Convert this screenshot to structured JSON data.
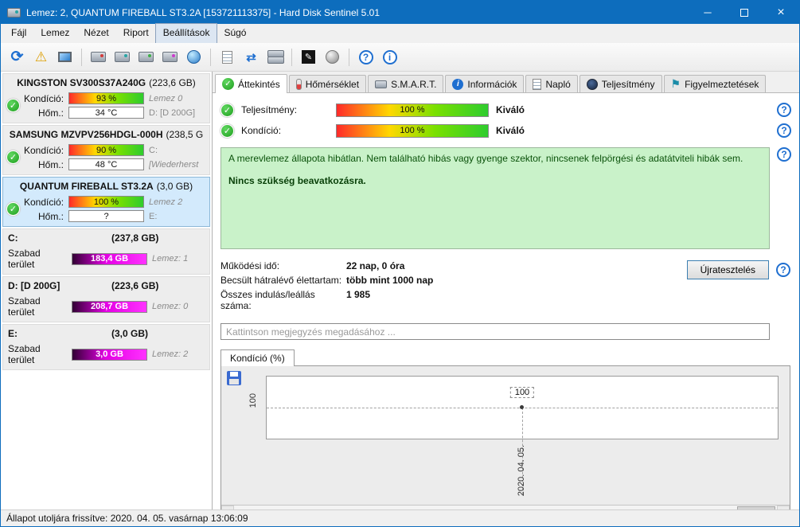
{
  "window": {
    "title": "Lemez: 2, QUANTUM FIREBALL ST3.2A [153721113375]  -  Hard Disk Sentinel 5.01"
  },
  "menu": {
    "items": [
      "Fájl",
      "Lemez",
      "Nézet",
      "Riport",
      "Beállítások",
      "Súgó"
    ]
  },
  "icons": {
    "check": "✓",
    "refresh": "⟳",
    "warning": "⚠",
    "sync": "⇄",
    "pencil": "✎",
    "flag": "⚑",
    "help": "?",
    "info": "i",
    "minimize": "─",
    "close": "×",
    "scroll_left": "◀",
    "scroll_right": "▶"
  },
  "colors": {
    "titlebar": "#0d6dbd",
    "accent_blue": "#1f6fd0",
    "selected_disk": "#d3eafc",
    "health_bg": "#c9f2c9",
    "health_text": "#0a520a",
    "status_green": "#1f9e1f",
    "condition_gradient_start": "#ff2a2a",
    "condition_gradient_mid": "#ffd800",
    "condition_gradient_end": "#2ecc2e",
    "free_space_magenta": "#e400e4"
  },
  "sidebar": {
    "disks": [
      {
        "name": "KINGSTON SV300S37A240G",
        "size": "(223,6 GB)",
        "condition_label": "Kondíció:",
        "condition_value": "93 %",
        "condition_note": "Lemez 0",
        "temp_label": "Hőm.:",
        "temp_value": "34 °C",
        "temp_note": "D: [D 200G]"
      },
      {
        "name": "SAMSUNG MZVPV256HDGL-000H",
        "size": "(238,5 G",
        "condition_label": "Kondíció:",
        "condition_value": "90 %",
        "condition_note": "C:",
        "temp_label": "Hőm.:",
        "temp_value": "48 °C",
        "temp_note": "[Wiederherst"
      },
      {
        "name": "QUANTUM FIREBALL ST3.2A",
        "size": "(3,0 GB)",
        "condition_label": "Kondíció:",
        "condition_value": "100 %",
        "condition_note": "Lemez 2",
        "temp_label": "Hőm.:",
        "temp_value": "?",
        "temp_note": "E:"
      }
    ],
    "partitions": [
      {
        "name": "C:",
        "size": "(237,8 GB)",
        "free_label": "Szabad terület",
        "free_value": "183,4 GB",
        "note": "Lemez: 1"
      },
      {
        "name": "D: [D 200G]",
        "size": "(223,6 GB)",
        "free_label": "Szabad terület",
        "free_value": "208,7 GB",
        "note": "Lemez: 0"
      },
      {
        "name": "E:",
        "size": "(3,0 GB)",
        "free_label": "Szabad terület",
        "free_value": "3,0 GB",
        "note": "Lemez: 2"
      }
    ]
  },
  "tabs": [
    {
      "label": "Áttekintés"
    },
    {
      "label": "Hőmérséklet"
    },
    {
      "label": "S.M.A.R.T."
    },
    {
      "label": "Információk"
    },
    {
      "label": "Napló"
    },
    {
      "label": "Teljesítmény"
    },
    {
      "label": "Figyelmeztetések"
    }
  ],
  "overview": {
    "performance_label": "Teljesítmény:",
    "performance_value": "100 %",
    "performance_rating": "Kiváló",
    "condition_label": "Kondíció:",
    "condition_value": "100 %",
    "condition_rating": "Kiváló",
    "health_text": "A merevlemez állapota hibátlan. Nem található hibás vagy gyenge szektor, nincsenek felpörgési és adatátviteli hibák sem.",
    "action_text": "Nincs szükség beavatkozásra.",
    "stats": [
      {
        "label": "Működési idő:",
        "value": "22 nap, 0 óra"
      },
      {
        "label": "Becsült hátralévő élettartam:",
        "value": "több mint 1000 nap"
      },
      {
        "label": "Összes indulás/leállás száma:",
        "value": "1 985"
      }
    ],
    "retest_button": "Újratesztelés",
    "comment_placeholder": "Kattintson megjegyzés megadásához ..."
  },
  "chart": {
    "tab_label": "Kondíció  (%)",
    "y_axis_label": "100",
    "point_label": "100",
    "x_axis_label": "2020. 04. 05."
  },
  "chart_data": {
    "type": "line",
    "title": "Kondíció (%)",
    "x": [
      "2020. 04. 05."
    ],
    "values": [
      100
    ],
    "ylim": [
      0,
      100
    ],
    "grid": "dashed"
  },
  "statusbar": {
    "text": "Állapot utoljára frissítve: 2020. 04. 05. vasárnap 13:06:09"
  }
}
